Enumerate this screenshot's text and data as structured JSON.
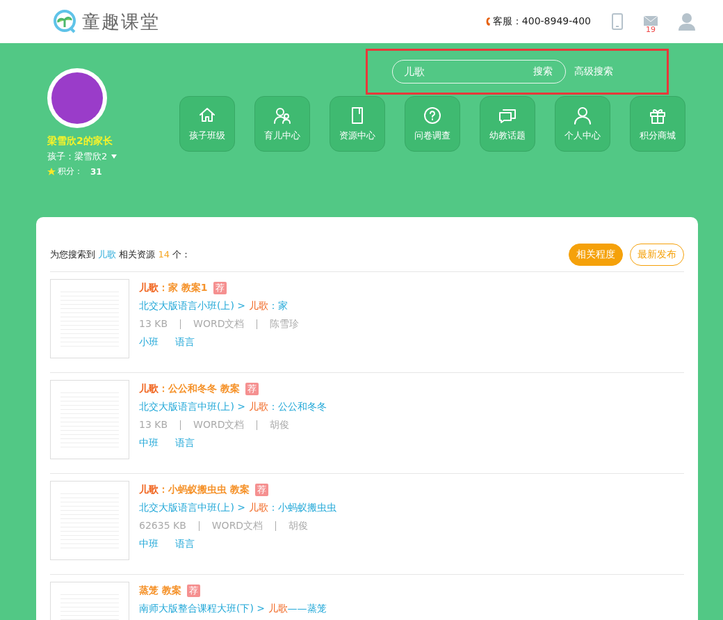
{
  "header": {
    "logo_text": "童趣课堂",
    "service_label": "客服：",
    "service_phone": "400-8949-400",
    "mail_count": "19"
  },
  "search": {
    "value": "儿歌",
    "button": "搜索",
    "advanced": "高级搜索"
  },
  "profile": {
    "name": "梁雪欣2的家长",
    "child": "孩子：梁雪欣2",
    "points_label": "积分：",
    "points": "31"
  },
  "nav": [
    {
      "label": "孩子班级",
      "kind": "home"
    },
    {
      "label": "育儿中心",
      "kind": "parents"
    },
    {
      "label": "资源中心",
      "kind": "book"
    },
    {
      "label": "问卷调查",
      "kind": "question"
    },
    {
      "label": "幼教话题",
      "kind": "chat"
    },
    {
      "label": "个人中心",
      "kind": "person"
    },
    {
      "label": "积分商城",
      "kind": "gift"
    }
  ],
  "results": {
    "summary_prefix": "为您搜索到",
    "query": "儿歌",
    "summary_mid": "相关资源",
    "count": "14",
    "summary_suffix": "个：",
    "sort": [
      {
        "label": "相关程度",
        "selected": true
      },
      {
        "label": "最新发布",
        "selected": false
      }
    ],
    "items": [
      {
        "title_match": "儿歌",
        "title_rest": "：家 教案1",
        "badge": "荐",
        "path_prefix": "北交大版语言小班(上) > ",
        "path_match": "儿歌",
        "path_rest": "：家",
        "size": "13 KB",
        "format": "WORD文档",
        "author": "陈雪珍",
        "tags": [
          "小班",
          "语言"
        ]
      },
      {
        "title_match": "儿歌",
        "title_rest": "：公公和冬冬 教案",
        "badge": "荐",
        "path_prefix": "北交大版语言中班(上) > ",
        "path_match": "儿歌",
        "path_rest": "：公公和冬冬",
        "size": "13 KB",
        "format": "WORD文档",
        "author": "胡俊",
        "tags": [
          "中班",
          "语言"
        ]
      },
      {
        "title_match": "儿歌",
        "title_rest": "：小蚂蚁搬虫虫 教案",
        "badge": "荐",
        "path_prefix": "北交大版语言中班(上) > ",
        "path_match": "儿歌",
        "path_rest": "：小蚂蚁搬虫虫",
        "size": "62635 KB",
        "format": "WORD文档",
        "author": "胡俊",
        "tags": [
          "中班",
          "语言"
        ]
      },
      {
        "title_rest": "蒸笼 教案",
        "badge": "荐",
        "path_prefix": "南师大版整合课程大班(下) > ",
        "path_match": "儿歌",
        "path_rest": "——蒸笼"
      }
    ]
  }
}
